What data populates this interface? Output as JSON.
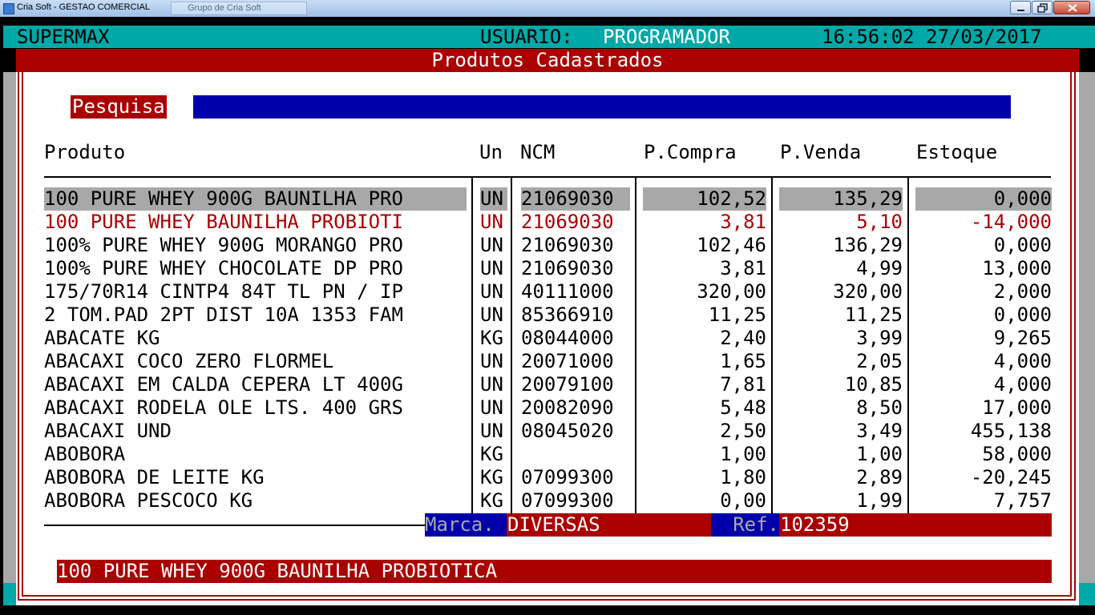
{
  "window": {
    "title": "Cria Soft - GESTAO COMERCIAL",
    "background_tab": "Grupo de Cria Soft"
  },
  "status": {
    "app_name": "SUPERMAX",
    "user_label": "USUARIO:",
    "user_value": "PROGRAMADOR",
    "datetime": "16:56:02 27/03/2017"
  },
  "panel": {
    "title": "Produtos Cadastrados"
  },
  "search": {
    "label": "Pesquisa",
    "value": ""
  },
  "table": {
    "headers": {
      "produto": "Produto",
      "un": "Un",
      "ncm": "NCM",
      "p_compra": "P.Compra",
      "p_venda": "P.Venda",
      "estoque": "Estoque"
    },
    "rows": [
      {
        "produto": "100 PURE WHEY 900G BAUNILHA PRO",
        "un": "UN",
        "ncm": "21069030",
        "p_compra": "102,52",
        "p_venda": "135,29",
        "estoque": "0,000"
      },
      {
        "produto": "100 PURE WHEY BAUNILHA PROBIOTI",
        "un": "UN",
        "ncm": "21069030",
        "p_compra": "3,81",
        "p_venda": "5,10",
        "estoque": "-14,000"
      },
      {
        "produto": "100% PURE WHEY 900G MORANGO PRO",
        "un": "UN",
        "ncm": "21069030",
        "p_compra": "102,46",
        "p_venda": "136,29",
        "estoque": "0,000"
      },
      {
        "produto": "100% PURE WHEY CHOCOLATE DP PRO",
        "un": "UN",
        "ncm": "21069030",
        "p_compra": "3,81",
        "p_venda": "4,99",
        "estoque": "13,000"
      },
      {
        "produto": "175/70R14 CINTP4 84T TL PN / IP",
        "un": "UN",
        "ncm": "40111000",
        "p_compra": "320,00",
        "p_venda": "320,00",
        "estoque": "2,000"
      },
      {
        "produto": "2 TOM.PAD 2PT DIST 10A 1353 FAM",
        "un": "UN",
        "ncm": "85366910",
        "p_compra": "11,25",
        "p_venda": "11,25",
        "estoque": "0,000"
      },
      {
        "produto": "ABACATE KG",
        "un": "KG",
        "ncm": "08044000",
        "p_compra": "2,40",
        "p_venda": "3,99",
        "estoque": "9,265"
      },
      {
        "produto": "ABACAXI COCO ZERO FLORMEL",
        "un": "UN",
        "ncm": "20071000",
        "p_compra": "1,65",
        "p_venda": "2,05",
        "estoque": "4,000"
      },
      {
        "produto": "ABACAXI EM CALDA CEPERA LT 400G",
        "un": "UN",
        "ncm": "20079100",
        "p_compra": "7,81",
        "p_venda": "10,85",
        "estoque": "4,000"
      },
      {
        "produto": "ABACAXI RODELA OLE LTS. 400 GRS",
        "un": "UN",
        "ncm": "20082090",
        "p_compra": "5,48",
        "p_venda": "8,50",
        "estoque": "17,000"
      },
      {
        "produto": "ABACAXI UND",
        "un": "UN",
        "ncm": "08045020",
        "p_compra": "2,50",
        "p_venda": "3,49",
        "estoque": "455,138"
      },
      {
        "produto": "ABOBORA",
        "un": "KG",
        "ncm": "",
        "p_compra": "1,00",
        "p_venda": "1,00",
        "estoque": "58,000"
      },
      {
        "produto": "ABOBORA DE LEITE KG",
        "un": "KG",
        "ncm": "07099300",
        "p_compra": "1,80",
        "p_venda": "2,89",
        "estoque": "-20,245"
      },
      {
        "produto": "ABOBORA PESCOCO KG",
        "un": "KG",
        "ncm": "07099300",
        "p_compra": "0,00",
        "p_venda": "1,99",
        "estoque": "7,757"
      }
    ],
    "selected_index": 0,
    "alert_indices": [
      1
    ]
  },
  "footer": {
    "marca_label": "Marca.",
    "marca_value": "DIVERSAS",
    "ref_label": "Ref.",
    "ref_value": "102359",
    "description": "100 PURE WHEY 900G BAUNILHA PROBIOTICA"
  },
  "colors": {
    "teal": "#00a8a8",
    "red": "#aa0000",
    "blue": "#0000aa",
    "gray": "#a8a8a8"
  }
}
